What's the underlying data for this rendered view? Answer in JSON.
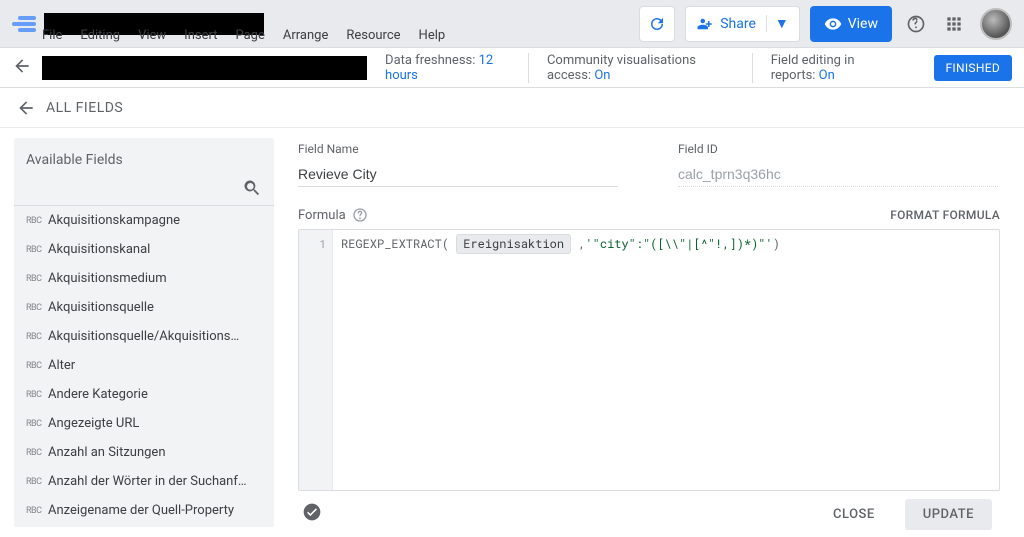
{
  "menu": [
    "File",
    "Editing",
    "View",
    "Insert",
    "Page",
    "Arrange",
    "Resource",
    "Help"
  ],
  "topbar": {
    "share_label": "Share",
    "view_label": "View"
  },
  "dsbar": {
    "freshness_label": "Data freshness: ",
    "freshness_value": "12 hours",
    "vis_label": "Community visualisations access: ",
    "vis_value": "On",
    "edit_label": "Field editing in reports: ",
    "edit_value": "On",
    "finished": "FINISHED"
  },
  "all_fields": "ALL FIELDS",
  "sidebar": {
    "title": "Available Fields",
    "fields": [
      "Akquisitionskampagne",
      "Akquisitionskanal",
      "Akquisitionsmedium",
      "Akquisitionsquelle",
      "Akquisitionsquelle/Akquisitions…",
      "Alter",
      "Andere Kategorie",
      "Angezeigte URL",
      "Anzahl an Sitzungen",
      "Anzahl der Wörter in der Suchanf…",
      "Anzeigename der Quell-Property"
    ]
  },
  "field_name_label": "Field Name",
  "field_name_value": "Revieve City",
  "field_id_label": "Field ID",
  "field_id_value": "calc_tprn3q36hc",
  "formula_label": "Formula",
  "format_formula": "FORMAT FORMULA",
  "code": {
    "line": "1",
    "fn": "REGEXP_EXTRACT",
    "chip": "Ereignisaktion",
    "str": "'\"city\":\"([\\\\\"|[^\"!,])*)\"'"
  },
  "footer": {
    "close": "CLOSE",
    "update": "UPDATE"
  }
}
